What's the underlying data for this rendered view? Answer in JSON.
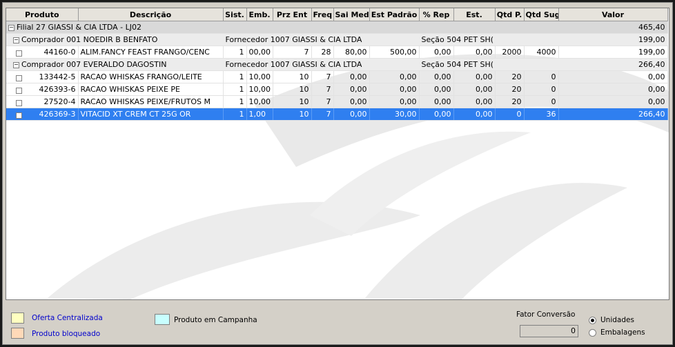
{
  "columns": [
    "Produto",
    "Descrição",
    "Sist.",
    "Emb.",
    "Prz Ent",
    "Freq",
    "Sai Med",
    "Est Padrão",
    "% Rep",
    "Est.",
    "Qtd P.",
    "Qtd Sug",
    "Valor"
  ],
  "filial": {
    "label": "Filial 27 GIASSI & CIA LTDA - LJ02",
    "valor": "465,40"
  },
  "buyers": [
    {
      "label": "Comprador 001 NOEDIR B BENFATO",
      "fornecedor": "Fornecedor 1007 GIASSI & CIA LTDA",
      "secao": "Seção 504 PET SH(",
      "valor": "199,00"
    },
    {
      "label": "Comprador 007 EVERALDO DAGOSTIN",
      "fornecedor": "Fornecedor 1007 GIASSI & CIA LTDA",
      "secao": "Seção 504 PET SH(",
      "valor": "266,40"
    }
  ],
  "rows": [
    {
      "produto": "44160-0",
      "descricao": "ALIM.FANCY FEAST FRANGO/CENC",
      "sist": "1",
      "emb": "00,00",
      "prz": "7",
      "freq": "28",
      "saimed": "80,00",
      "estpadrao": "500,00",
      "rep": "0,00",
      "est": "0,00",
      "qtdp": "2000",
      "qtdsug": "4000",
      "valor": "199,00"
    },
    {
      "produto": "133442-5",
      "descricao": "RACAO WHISKAS FRANGO/LEITE",
      "sist": "1",
      "emb": "10,00",
      "prz": "10",
      "freq": "7",
      "saimed": "0,00",
      "estpadrao": "0,00",
      "rep": "0,00",
      "est": "0,00",
      "qtdp": "20",
      "qtdsug": "0",
      "valor": "0,00"
    },
    {
      "produto": "426393-6",
      "descricao": "RACAO WHISKAS PEIXE            PE",
      "sist": "1",
      "emb": "10,00",
      "prz": "10",
      "freq": "7",
      "saimed": "0,00",
      "estpadrao": "0,00",
      "rep": "0,00",
      "est": "0,00",
      "qtdp": "20",
      "qtdsug": "0",
      "valor": "0,00"
    },
    {
      "produto": "27520-4",
      "descricao": "RACAO WHISKAS PEIXE/FRUTOS M",
      "sist": "1",
      "emb": "10,00",
      "prz": "10",
      "freq": "7",
      "saimed": "0,00",
      "estpadrao": "0,00",
      "rep": "0,00",
      "est": "0,00",
      "qtdp": "20",
      "qtdsug": "0",
      "valor": "0,00"
    },
    {
      "produto": "426369-3",
      "descricao": "VITACID XT CREM CT 25G OR",
      "sist": "1",
      "emb": "1,00",
      "prz": "10",
      "freq": "7",
      "saimed": "0,00",
      "estpadrao": "30,00",
      "rep": "0,00",
      "est": "0,00",
      "qtdp": "0",
      "qtdsug": "36",
      "valor": "266,40"
    }
  ],
  "legend": {
    "oferta": "Oferta Centralizada",
    "bloqueado": "Produto bloqueado",
    "campanha": "Produto em Campanha",
    "fator_label": "Fator Conversão",
    "fator_value": "0",
    "unidades": "Unidades",
    "embalagens": "Embalagens",
    "colors": {
      "oferta": "#ffffc0",
      "bloqueado": "#ffd9b8",
      "campanha": "#c8ffff",
      "link": "#0000cc"
    }
  }
}
